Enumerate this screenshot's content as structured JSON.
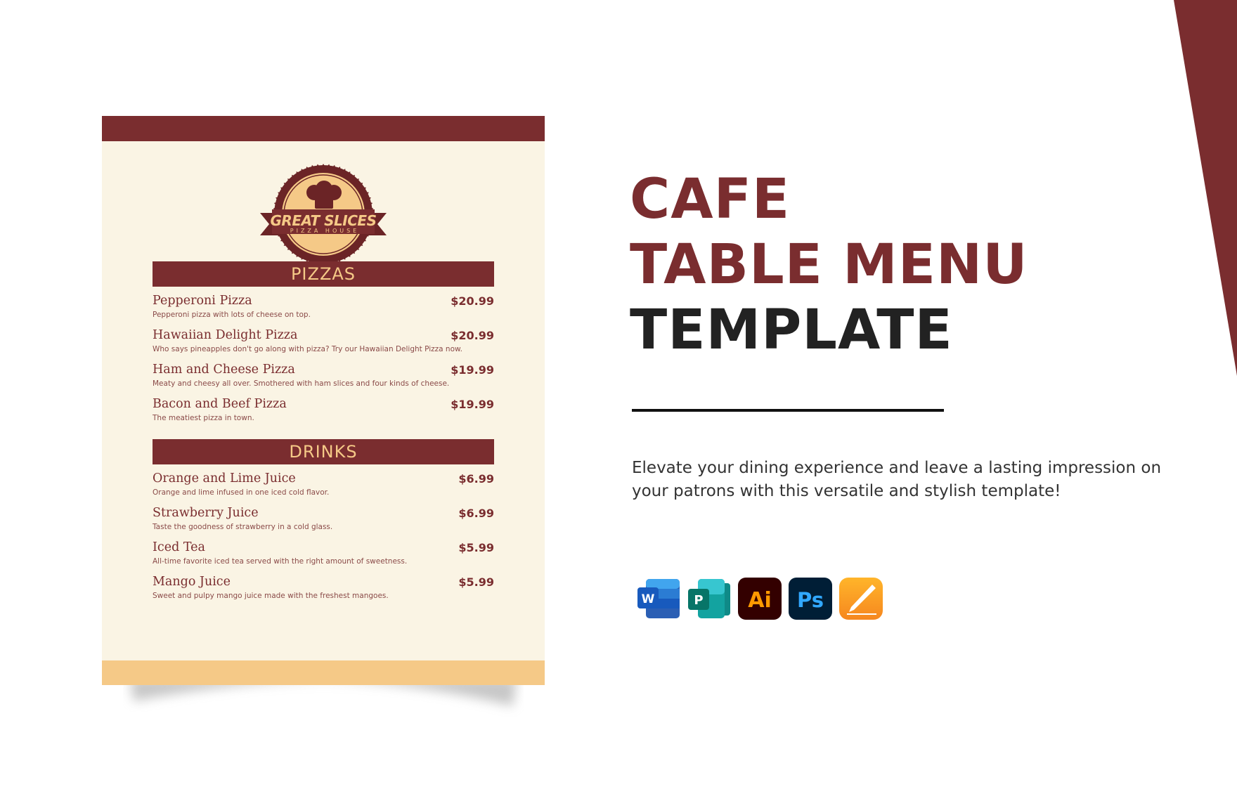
{
  "colors": {
    "brand_maroon": "#7a2d2f",
    "accent_gold": "#f5c987",
    "card_bg": "#faf4e4",
    "title_dark": "#222222"
  },
  "menu_card": {
    "logo": {
      "name": "GREAT SLICES",
      "tagline": "PIZZA HOUSE",
      "icon": "chef-hat-icon"
    },
    "sections": [
      {
        "title": "PIZZAS",
        "items": [
          {
            "name": "Pepperoni Pizza",
            "price": "$20.99",
            "description": "Pepperoni pizza with lots of cheese on top."
          },
          {
            "name": "Hawaiian Delight Pizza",
            "price": "$20.99",
            "description": "Who says pineapples don't go along with pizza? Try our Hawaiian Delight Pizza now."
          },
          {
            "name": "Ham and Cheese Pizza",
            "price": "$19.99",
            "description": "Meaty and cheesy all over. Smothered with ham slices and four kinds of cheese."
          },
          {
            "name": "Bacon and Beef Pizza",
            "price": "$19.99",
            "description": "The meatiest pizza in town."
          }
        ]
      },
      {
        "title": "DRINKS",
        "items": [
          {
            "name": "Orange and Lime Juice",
            "price": "$6.99",
            "description": "Orange and lime infused in one iced cold flavor."
          },
          {
            "name": "Strawberry Juice",
            "price": "$6.99",
            "description": "Taste the goodness of strawberry in a cold glass."
          },
          {
            "name": "Iced Tea",
            "price": "$5.99",
            "description": "All-time favorite iced tea served with the right amount of sweetness."
          },
          {
            "name": "Mango Juice",
            "price": "$5.99",
            "description": "Sweet and pulpy mango juice made with the freshest mangoes."
          }
        ]
      }
    ]
  },
  "hero": {
    "title_line_1": "CAFE",
    "title_line_2": "TABLE MENU",
    "title_line_3": "TEMPLATE",
    "description": "Elevate your dining experience and leave a lasting impression on your patrons with this versatile and stylish template!"
  },
  "apps": [
    {
      "icon": "microsoft-word-icon",
      "letter": "W"
    },
    {
      "icon": "microsoft-publisher-icon",
      "letter": "P"
    },
    {
      "icon": "adobe-illustrator-icon",
      "letter": "Ai"
    },
    {
      "icon": "adobe-photoshop-icon",
      "letter": "Ps"
    },
    {
      "icon": "apple-pages-icon",
      "letter": ""
    }
  ]
}
